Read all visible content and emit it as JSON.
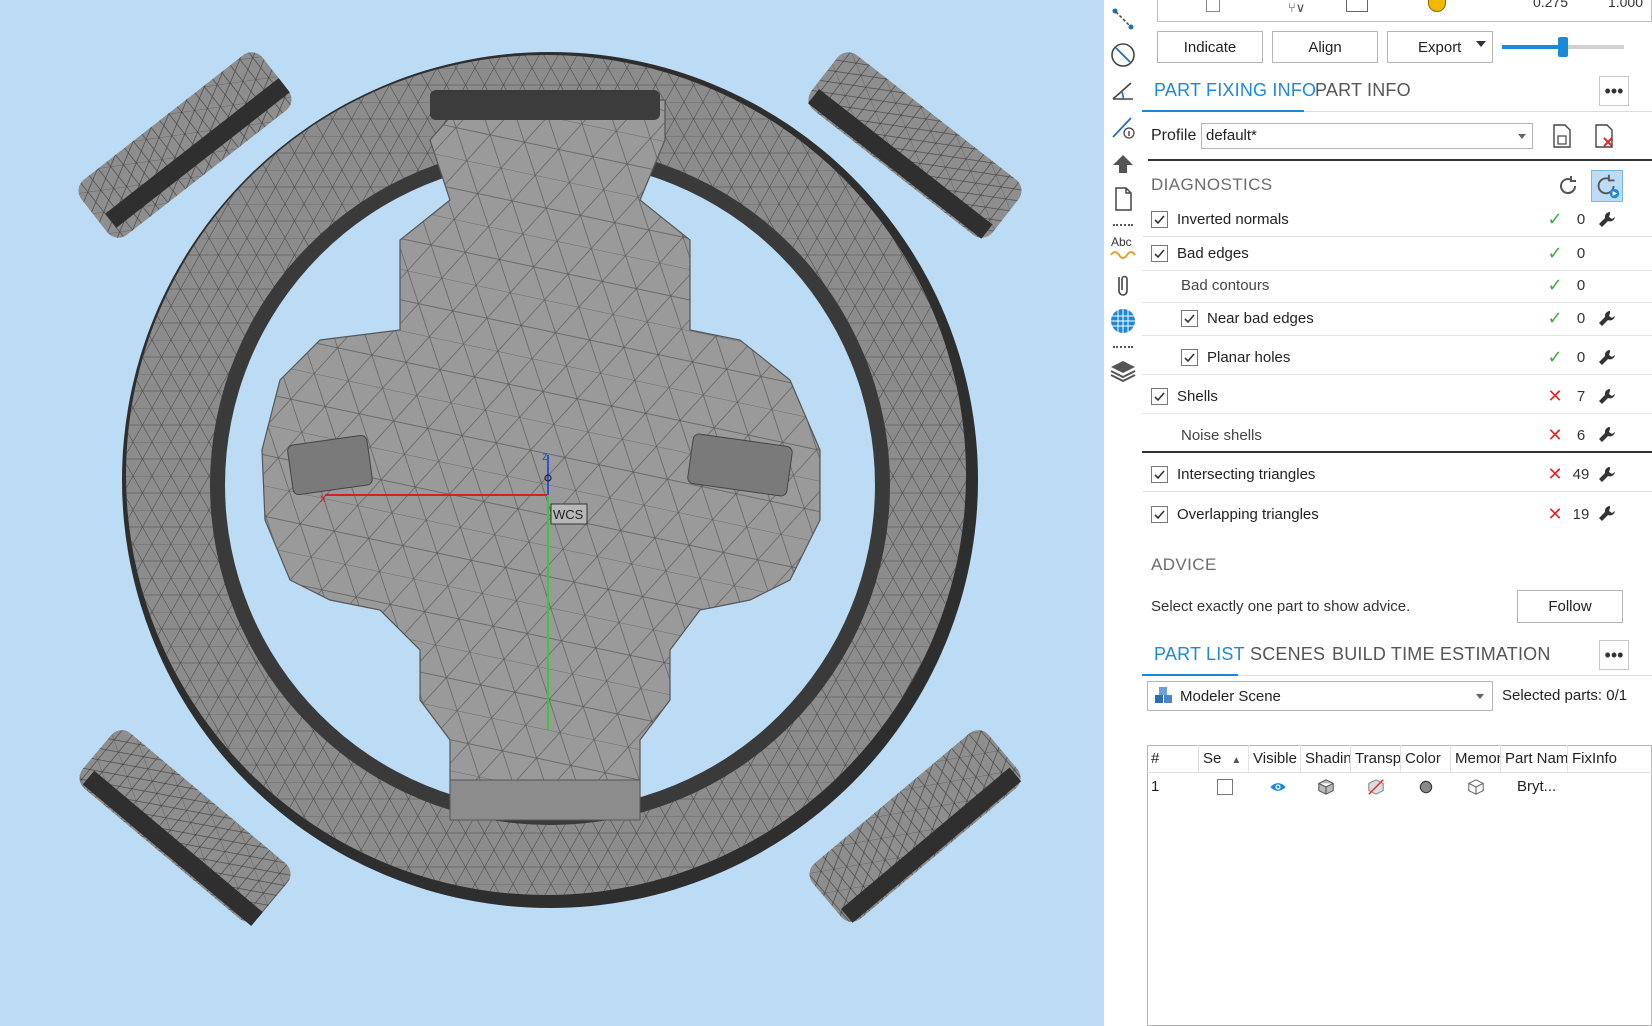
{
  "viewport": {
    "bg_color": "#bcdcf6",
    "wcs_label": "WCS",
    "axis_labels": {
      "x": "x",
      "z": "z"
    },
    "colors": {
      "x_axis": "#d42020",
      "y_axis": "#3ec43e",
      "z_axis": "#3050d0",
      "mesh_fill": "#9a9a9a",
      "mesh_line": "#4a4a4a"
    }
  },
  "toolbar": {
    "icons": [
      "connect-points-icon",
      "measure-circle-icon",
      "measure-angle-icon",
      "measure-distance-info-icon",
      "pin-tool-icon",
      "page-icon",
      "spell-check-icon",
      "paperclip-icon",
      "mesh-grid-icon",
      "layers-icon"
    ],
    "spell_text": "Abc"
  },
  "panel": {
    "top_values": [
      "0.275",
      "1.000"
    ],
    "buttons": {
      "indicate": "Indicate",
      "align": "Align",
      "export": "Export"
    },
    "slider_position": 0.5,
    "tabs_top": [
      {
        "label": "PART FIXING INFO",
        "active": true
      },
      {
        "label": "PART INFO",
        "active": false
      }
    ],
    "more_label": "•••",
    "profile": {
      "label": "Profile",
      "value": "default*"
    },
    "diagnostics": {
      "title": "DIAGNOSTICS",
      "rows": [
        {
          "label": "Inverted normals",
          "checkbox": true,
          "checked": true,
          "indent": 0,
          "status": "ok",
          "count": "0",
          "wrench": true
        },
        {
          "label": "Bad edges",
          "checkbox": true,
          "checked": true,
          "indent": 0,
          "status": "ok",
          "count": "0",
          "wrench": false
        },
        {
          "label": "Bad contours",
          "checkbox": false,
          "checked": false,
          "indent": 1,
          "status": "ok",
          "count": "0",
          "wrench": false
        },
        {
          "label": "Near bad edges",
          "checkbox": true,
          "checked": true,
          "indent": 1,
          "status": "ok",
          "count": "0",
          "wrench": true
        },
        {
          "label": "Planar holes",
          "checkbox": true,
          "checked": true,
          "indent": 1,
          "status": "ok",
          "count": "0",
          "wrench": true
        },
        {
          "label": "Shells",
          "checkbox": true,
          "checked": true,
          "indent": 0,
          "status": "bad",
          "count": "7",
          "wrench": true
        },
        {
          "label": "Noise shells",
          "checkbox": false,
          "checked": false,
          "indent": 1,
          "status": "bad",
          "count": "6",
          "wrench": true
        },
        {
          "label": "Intersecting triangles",
          "checkbox": true,
          "checked": true,
          "indent": 0,
          "status": "bad",
          "count": "49",
          "wrench": true
        },
        {
          "label": "Overlapping triangles",
          "checkbox": true,
          "checked": true,
          "indent": 0,
          "status": "bad",
          "count": "19",
          "wrench": true
        }
      ],
      "ok_symbol": "✓",
      "bad_symbol": "✕"
    },
    "advice": {
      "title": "ADVICE",
      "text": "Select exactly one part to show advice.",
      "follow_label": "Follow"
    },
    "tabs_bottom": [
      {
        "label": "PART LIST",
        "active": true
      },
      {
        "label": "SCENES",
        "active": false
      },
      {
        "label": "BUILD TIME ESTIMATION",
        "active": false
      }
    ],
    "scene_select": {
      "value": "Modeler Scene"
    },
    "selected_parts": "Selected parts:  0/1",
    "grid": {
      "columns": [
        "#",
        "Se",
        "Visible",
        "Shading",
        "Transparency",
        "Color",
        "Memory",
        "Part Name",
        "FixInfo"
      ],
      "rows": [
        {
          "num": "1",
          "name": "Bryt..."
        }
      ]
    },
    "accent": "#1e88d8"
  }
}
